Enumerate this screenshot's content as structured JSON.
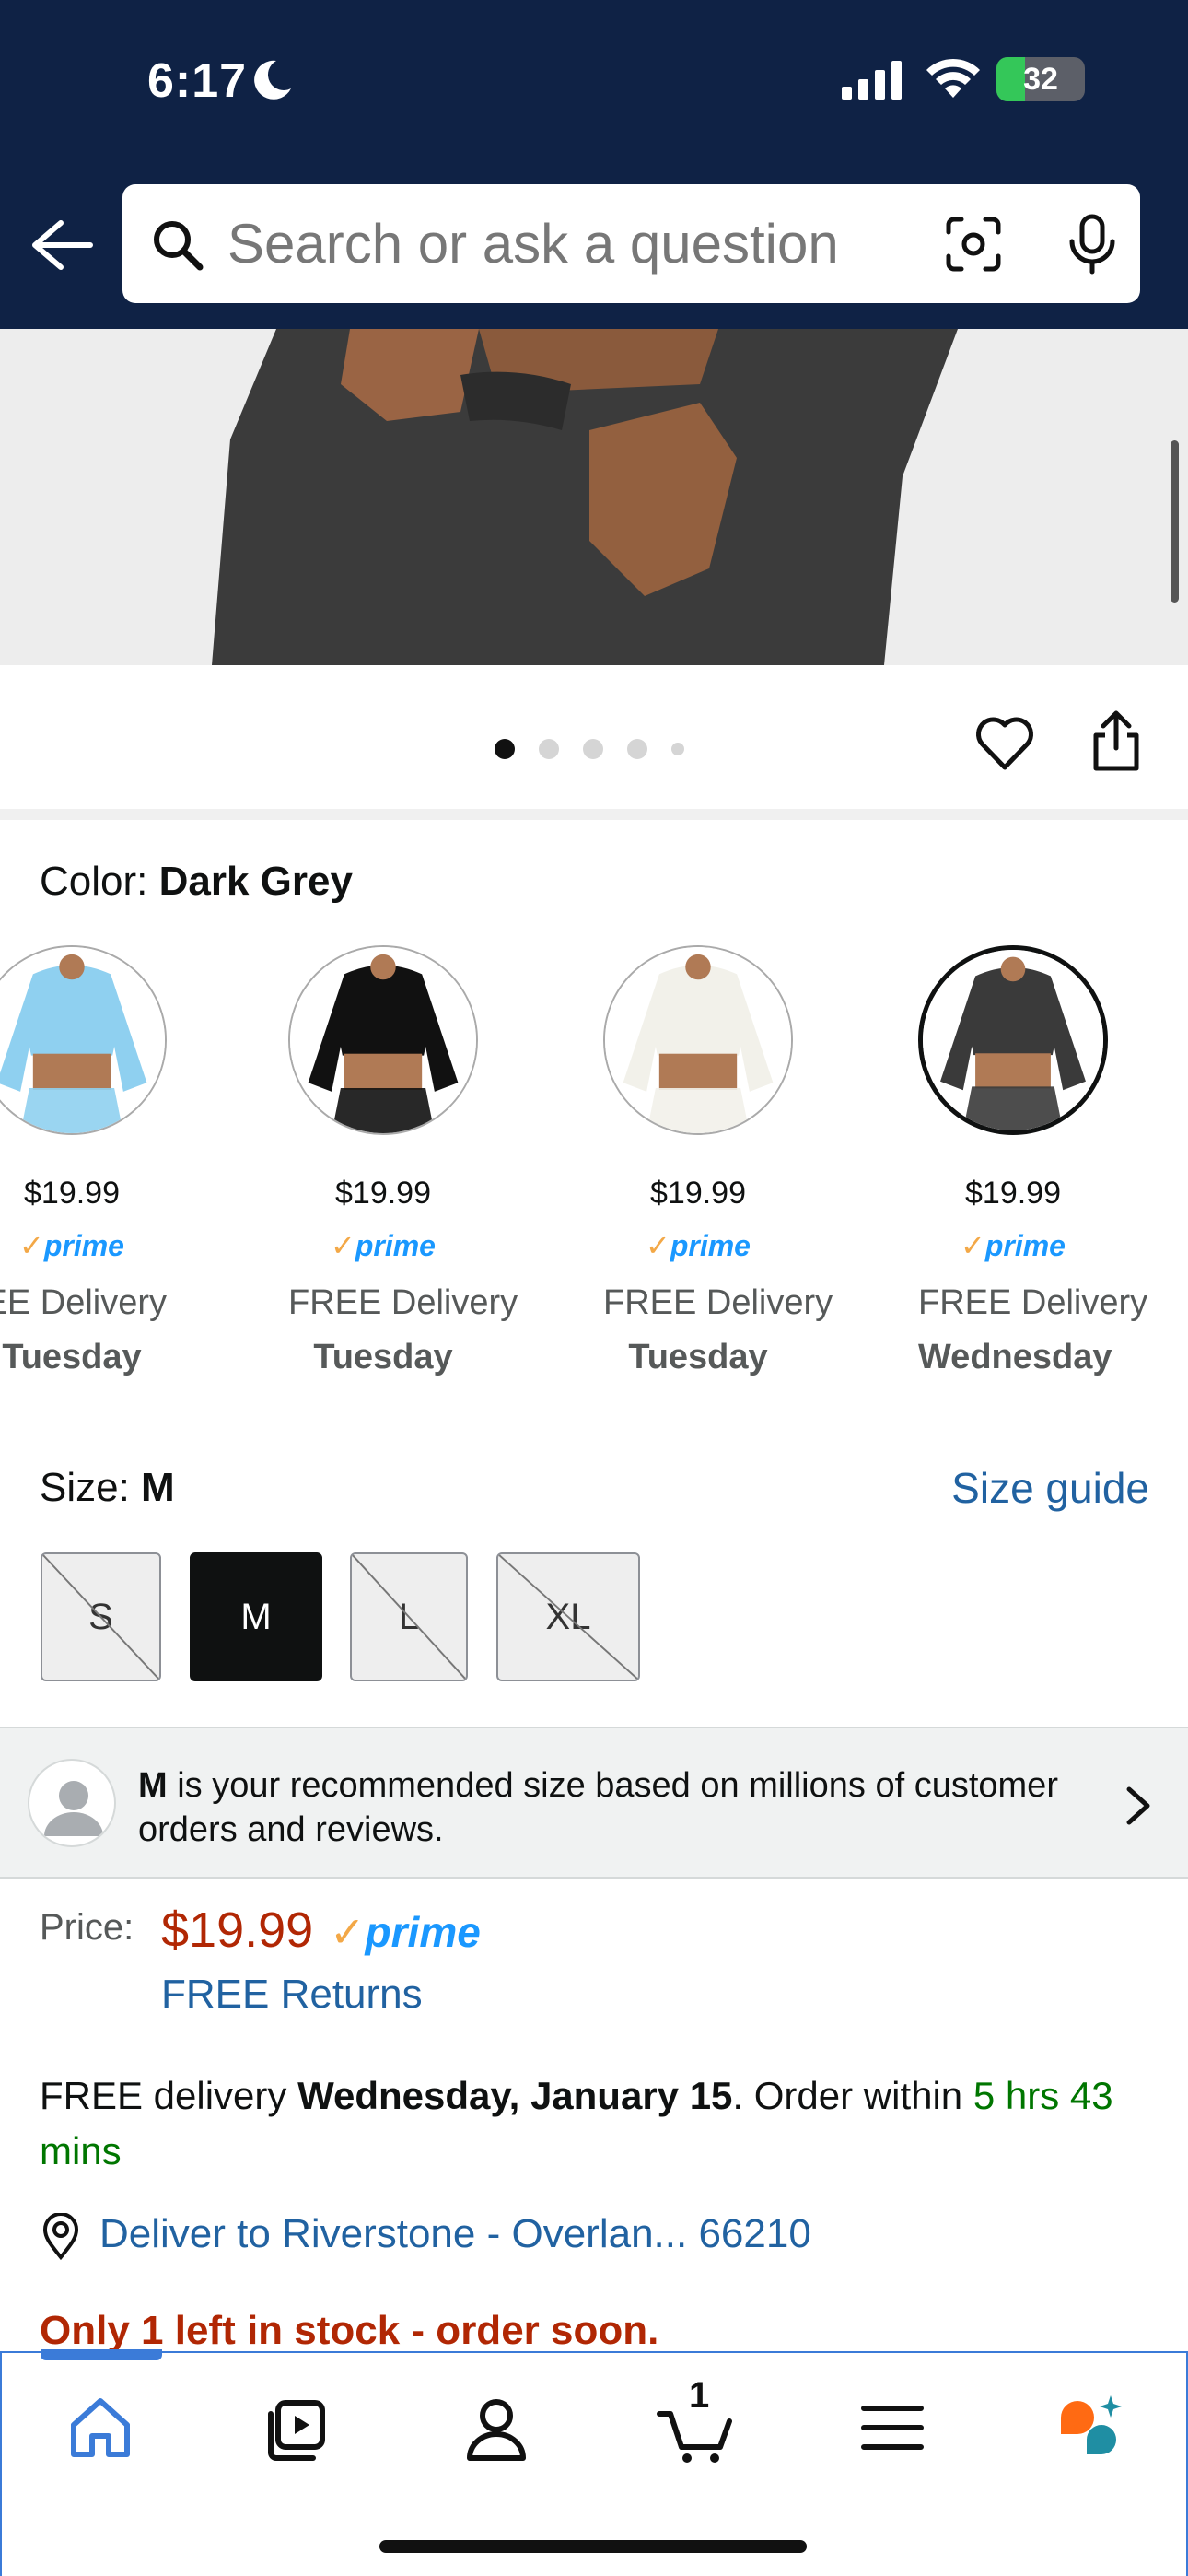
{
  "status_bar": {
    "time": "6:17",
    "battery_percent": "32"
  },
  "search": {
    "placeholder": "Search or ask a question"
  },
  "gallery": {
    "active_dot_index": 0,
    "dot_count": 5
  },
  "color": {
    "label": "Color: ",
    "selected": "Dark Grey"
  },
  "swatches": [
    {
      "name": "light-blue",
      "price": "$19.99",
      "prime": "prime",
      "delivery": "EE Delivery",
      "day": "Tuesday",
      "color": "#8fd0f0",
      "selected": false
    },
    {
      "name": "black",
      "price": "$19.99",
      "prime": "prime",
      "delivery": "FREE Delivery",
      "day": "Tuesday",
      "color": "#111111",
      "selected": false
    },
    {
      "name": "white",
      "price": "$19.99",
      "prime": "prime",
      "delivery": "FREE Delivery",
      "day": "Tuesday",
      "color": "#f2f1ea",
      "selected": false
    },
    {
      "name": "dark-grey",
      "price": "$19.99",
      "prime": "prime",
      "delivery": "FREE Delivery",
      "day": "Wednesday",
      "color": "#3a3a3a",
      "selected": true
    }
  ],
  "size": {
    "label": "Size: ",
    "selected": "M",
    "guide_link": "Size guide",
    "options": [
      "S",
      "M",
      "L",
      "XL"
    ]
  },
  "recommendation": {
    "size": "M",
    "text": " is your recommended size based on millions of customer orders and reviews."
  },
  "price": {
    "label": "Price:",
    "value": "$19.99",
    "prime": "prime",
    "returns": "FREE Returns"
  },
  "delivery": {
    "prefix": "FREE delivery ",
    "date": "Wednesday, January 15",
    "middle": ". Order within ",
    "countdown": "5 hrs 43 mins"
  },
  "location": {
    "text": "Deliver to Riverstone - Overlan... 66210"
  },
  "stock": {
    "text": "Only 1 left in stock - order soon."
  },
  "tabbar": {
    "cart_count": "1"
  },
  "colors": {
    "header_bg": "#0f2245",
    "price_red": "#b12704",
    "link_blue": "#2162a1",
    "prime_blue": "#1a98ff",
    "green": "#007600"
  }
}
